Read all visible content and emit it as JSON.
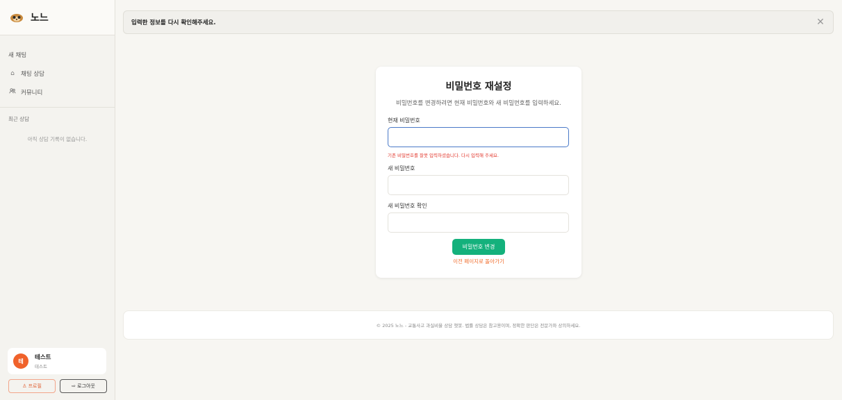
{
  "sidebar": {
    "brand_name": "노느",
    "nav": [
      {
        "label": "새 채팅",
        "icon": ""
      },
      {
        "label": "채팅 상담",
        "icon": "home-icon"
      },
      {
        "label": "커뮤니티",
        "icon": "users-icon"
      }
    ],
    "recent_title": "최근 상담",
    "empty_history": "아직 상담 기록이 없습니다.",
    "user": {
      "avatar_initial": "테",
      "name": "테스트",
      "sub": "테스트"
    },
    "profile_button": "♙ 프로필",
    "logout_button": "⇨ 로그아웃"
  },
  "alert": {
    "message": "입력한 정보를 다시 확인해주세요.",
    "close_symbol": "✕"
  },
  "card": {
    "title": "비밀번호 재설정",
    "description": "비밀번호를 변경하려면 현재 비밀번호와 새 비밀번호를 입력하세요.",
    "current_label": "현재 비밀번호",
    "current_value": "",
    "current_error": "기존 비밀번호를 잘못 입력하셨습니다. 다시 입력해 주세요.",
    "new_label": "새 비밀번호",
    "new_value": "",
    "confirm_label": "새 비밀번호 확인",
    "confirm_value": "",
    "submit_label": "비밀번호 변경",
    "back_link": "이전 페이지로 돌아가기"
  },
  "footer": {
    "text": "© 2025 노느 - 교통사고 과실비율 상담 챗봇. 법률 상담은 참고용이며, 정확한 판단은 전문가와 상의하세요."
  },
  "colors": {
    "accent_green": "#14b17c",
    "error_red": "#e2372c",
    "link_orange": "#f06c2c",
    "avatar_orange": "#f0622b",
    "focus_blue": "#4a79c8"
  }
}
